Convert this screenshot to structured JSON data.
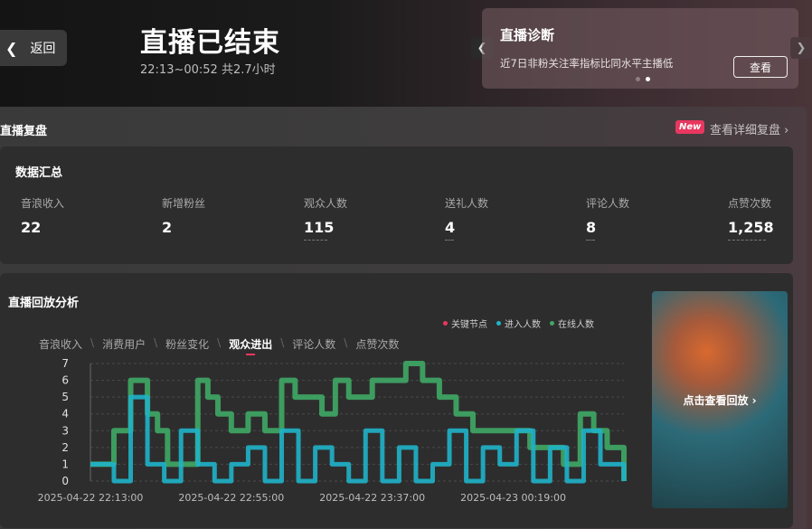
{
  "header": {
    "back_label": "返回",
    "title": "直播已结束",
    "subtitle": "22:13~00:52 共2.7小时"
  },
  "diagnosis": {
    "title": "直播诊断",
    "text": "近7日非粉关注率指标比同水平主播低",
    "button": "查看"
  },
  "review": {
    "title": "直播复盘",
    "badge": "New",
    "detail_link": "查看详细复盘 ›"
  },
  "summary": {
    "title": "数据汇总",
    "metrics": [
      {
        "label": "音浪收入",
        "value": "22"
      },
      {
        "label": "新增粉丝",
        "value": "2"
      },
      {
        "label": "观众人数",
        "value": "115"
      },
      {
        "label": "送礼人数",
        "value": "4"
      },
      {
        "label": "评论人数",
        "value": "8"
      },
      {
        "label": "点赞次数",
        "value": "1,258"
      }
    ]
  },
  "analysis": {
    "title": "直播回放分析",
    "tabs": [
      "音浪收入",
      "消费用户",
      "粉丝变化",
      "观众进出",
      "评论人数",
      "点赞次数"
    ],
    "active_tab": 3,
    "replay_label": "点击查看回放 ›"
  },
  "colors": {
    "key": "#e8375f",
    "enter": "#1fb3c9",
    "online": "#3fa865"
  },
  "chart_data": {
    "type": "line",
    "legend": [
      "关键节点",
      "进入人数",
      "在线人数"
    ],
    "x_ticks": [
      "2025-04-22 22:13:00",
      "2025-04-22 22:55:00",
      "2025-04-22 23:37:00",
      "2025-04-23 00:19:00"
    ],
    "y_ticks": [
      "0",
      "1",
      "2",
      "3",
      "4",
      "5",
      "6",
      "7"
    ],
    "ylim": [
      0,
      7
    ],
    "xlim": [
      "2025-04-22 22:13:00",
      "2025-04-23 00:52:00"
    ],
    "series": [
      {
        "name": "在线人数",
        "x": [
          "2025-04-22 22:13:00",
          "2025-04-22 22:20:00",
          "2025-04-22 22:25:00",
          "2025-04-22 22:30:00",
          "2025-04-22 22:33:00",
          "2025-04-22 22:36:00",
          "2025-04-22 22:40:00",
          "2025-04-22 22:45:00",
          "2025-04-22 22:48:00",
          "2025-04-22 22:51:00",
          "2025-04-22 22:55:00",
          "2025-04-22 23:00:00",
          "2025-04-22 23:05:00",
          "2025-04-22 23:10:00",
          "2025-04-22 23:14:00",
          "2025-04-22 23:18:00",
          "2025-04-22 23:22:00",
          "2025-04-22 23:26:00",
          "2025-04-22 23:30:00",
          "2025-04-22 23:34:00",
          "2025-04-22 23:37:00",
          "2025-04-22 23:42:00",
          "2025-04-22 23:47:00",
          "2025-04-22 23:52:00",
          "2025-04-22 23:57:00",
          "2025-04-23 00:02:00",
          "2025-04-23 00:07:00",
          "2025-04-23 00:12:00",
          "2025-04-23 00:16:00",
          "2025-04-23 00:19:00",
          "2025-04-23 00:24:00",
          "2025-04-23 00:29:00",
          "2025-04-23 00:34:00",
          "2025-04-23 00:39:00",
          "2025-04-23 00:43:00",
          "2025-04-23 00:47:00",
          "2025-04-23 00:52:00"
        ],
        "values": [
          1,
          3,
          6,
          4,
          3,
          1,
          1,
          6,
          5,
          4,
          3,
          4,
          3,
          6,
          5,
          5,
          4,
          6,
          5,
          5,
          6,
          6,
          7,
          6,
          5,
          4,
          3,
          3,
          3,
          3,
          2,
          2,
          1,
          4,
          3,
          2,
          0
        ]
      },
      {
        "name": "进入人数",
        "x": [
          "2025-04-22 22:13:00",
          "2025-04-22 22:20:00",
          "2025-04-22 22:25:00",
          "2025-04-22 22:30:00",
          "2025-04-22 22:35:00",
          "2025-04-22 22:40:00",
          "2025-04-22 22:45:00",
          "2025-04-22 22:50:00",
          "2025-04-22 22:55:00",
          "2025-04-22 23:00:00",
          "2025-04-22 23:05:00",
          "2025-04-22 23:10:00",
          "2025-04-22 23:15:00",
          "2025-04-22 23:20:00",
          "2025-04-22 23:25:00",
          "2025-04-22 23:30:00",
          "2025-04-22 23:35:00",
          "2025-04-22 23:40:00",
          "2025-04-22 23:45:00",
          "2025-04-22 23:50:00",
          "2025-04-22 23:55:00",
          "2025-04-23 00:00:00",
          "2025-04-23 00:05:00",
          "2025-04-23 00:10:00",
          "2025-04-23 00:15:00",
          "2025-04-23 00:20:00",
          "2025-04-23 00:25:00",
          "2025-04-23 00:30:00",
          "2025-04-23 00:35:00",
          "2025-04-23 00:40:00",
          "2025-04-23 00:45:00",
          "2025-04-23 00:52:00"
        ],
        "values": [
          1,
          0,
          5,
          1,
          0,
          3,
          1,
          0,
          1,
          2,
          0,
          3,
          0,
          2,
          1,
          0,
          3,
          0,
          2,
          0,
          1,
          3,
          0,
          2,
          1,
          3,
          0,
          2,
          0,
          3,
          1,
          0
        ]
      }
    ]
  }
}
